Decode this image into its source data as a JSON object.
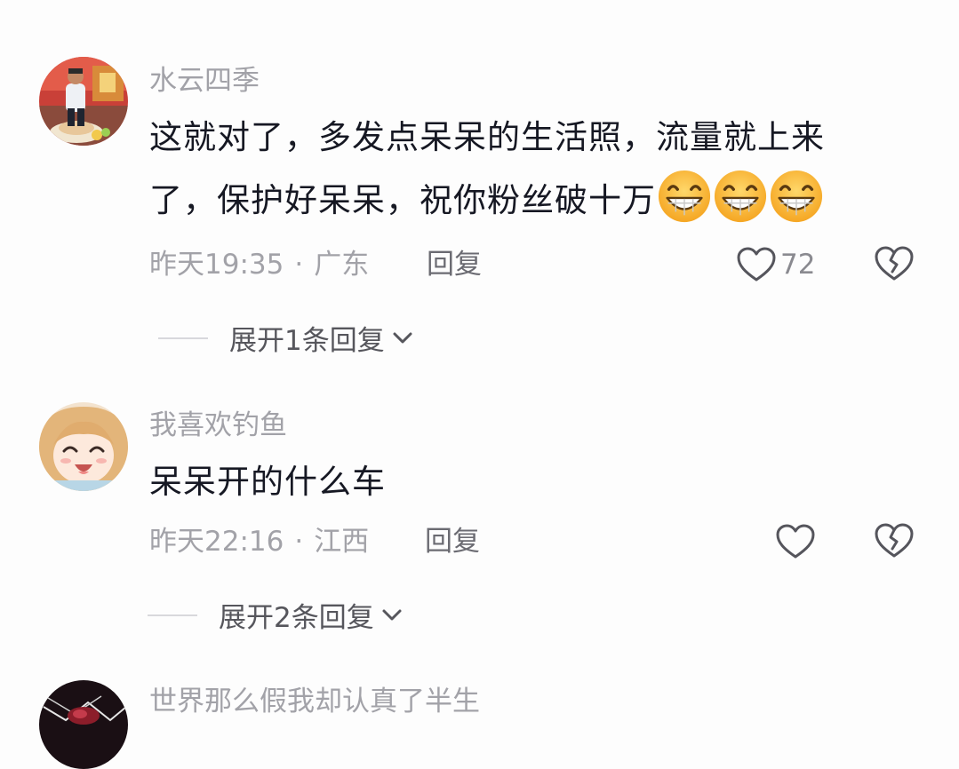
{
  "comments": [
    {
      "username": "水云四季",
      "content": "这就对了，多发点呆呆的生活照，流量就上来了，保护好呆呆，祝你粉丝破十万",
      "emojis": [
        "grin-emoji",
        "grin-emoji",
        "grin-emoji"
      ],
      "time": "昨天19:35",
      "separator": "·",
      "location": "广东",
      "reply_label": "回复",
      "like_count": "72",
      "expand_label": "展开1条回复"
    },
    {
      "username": "我喜欢钓鱼",
      "content": "呆呆开的什么车",
      "time": "昨天22:16",
      "separator": "·",
      "location": "江西",
      "reply_label": "回复",
      "like_count": "",
      "expand_label": "展开2条回复"
    },
    {
      "username": "世界那么假我却认真了半生"
    }
  ],
  "colors": {
    "text_primary": "#161823",
    "text_secondary": "#a2a2a8",
    "background": "#fdfdfd"
  },
  "icons": {
    "like": "heart-outline-icon",
    "dislike": "broken-heart-icon",
    "expand": "chevron-down-icon"
  }
}
